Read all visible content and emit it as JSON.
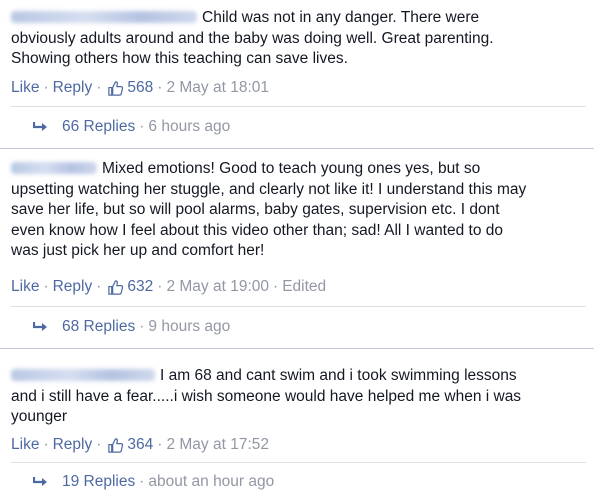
{
  "comments": [
    {
      "text_lines": [
        "Child was not in any danger. There were",
        "obviously adults around and the baby was doing well. Great parenting.",
        "Showing others how this teaching can save lives."
      ],
      "like": "Like",
      "reply": "Reply",
      "likes": "568",
      "time": "2 May at 18:01",
      "edited": "",
      "replies_label": "66 Replies",
      "replies_time": "6 hours ago"
    },
    {
      "text_lines": [
        "Mixed emotions! Good to teach young ones yes, but so",
        "upsetting watching her stuggle, and clearly not like it! I understand this may",
        "save her life, but so will pool alarms, baby gates, supervision etc. I dont",
        "even know how I feel about this video other than; sad! All I wanted to do",
        "was just pick her up and comfort her!"
      ],
      "like": "Like",
      "reply": "Reply",
      "likes": "632",
      "time": "2 May at 19:00",
      "edited": "Edited",
      "replies_label": "68 Replies",
      "replies_time": "9 hours ago"
    },
    {
      "text_lines": [
        "I am 68 and cant swim and i took swimming lessons",
        "and i still have a fear.....i wish someone would have helped me when i was",
        "younger"
      ],
      "like": "Like",
      "reply": "Reply",
      "likes": "364",
      "time": "2 May at 17:52",
      "edited": "",
      "replies_label": "19 Replies",
      "replies_time": "about an hour ago"
    }
  ],
  "icons": {
    "like": "thumbs-up-icon",
    "reply": "reply-arrow-icon"
  },
  "colors": {
    "link": "#4e69a2",
    "meta": "#9197a3",
    "text": "#141823",
    "divider": "#c4c9d3"
  }
}
